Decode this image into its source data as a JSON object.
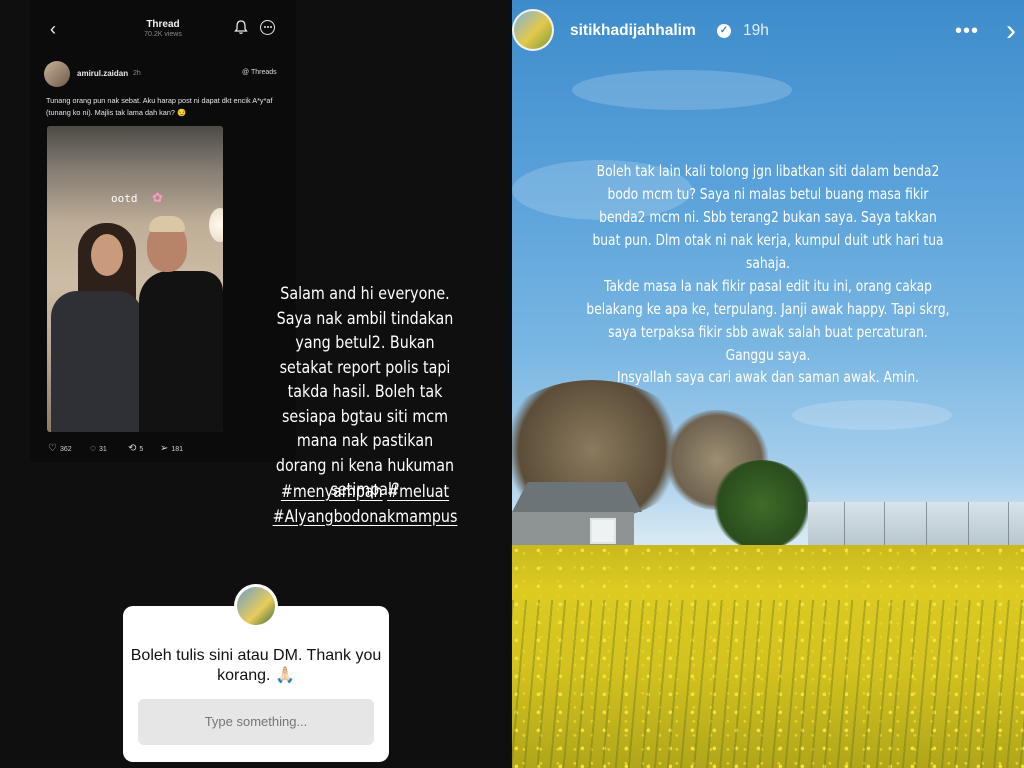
{
  "left_story": {
    "thread": {
      "title": "Thread",
      "views": "70.2K views",
      "post": {
        "username": "amirul.zaidan",
        "time": "2h",
        "source": "Threads",
        "text": "Tunang orang pun nak sebat. Aku harap post ni dapat dkt encik A*y*af (tunang ko ni). Majlis tak lama dah kan? 😏",
        "photo_caption": "ootd",
        "likes": "362",
        "comments": "31",
        "reposts": "5",
        "shares": "181"
      }
    },
    "story_text": "Salam and hi everyone. Saya nak ambil tindakan yang betul2. Bukan setakat report polis tapi takda hasil. Boleh tak sesiapa bgtau siti mcm mana nak pastikan dorang ni kena hukuman setimpal?",
    "hashtags": [
      "#menyampah",
      "#meluat",
      "#Alyangbodonakmampus"
    ],
    "question_box": {
      "prompt": "Boleh tulis sini atau DM. Thank you korang. 🙏🏻",
      "input_placeholder": "Type something..."
    }
  },
  "right_story": {
    "username": "sitikhadijahhalim",
    "time": "19h",
    "paragraphs": [
      "Boleh tak lain kali tolong jgn libatkan siti dalam benda2 bodo mcm tu? Saya ni malas betul buang masa fikir benda2 mcm ni. Sbb terang2 bukan saya. Saya takkan buat pun. Dlm otak ni nak kerja, kumpul duit utk hari tua sahaja.",
      "Takde masa la nak fikir pasal edit itu ini, orang cakap belakang ke apa ke, terpulang. Janji awak happy. Tapi skrg, saya terpaksa fikir sbb awak salah buat percaturan. Ganggu saya.",
      "Insyallah saya cari awak dan saman awak. Amin."
    ]
  }
}
